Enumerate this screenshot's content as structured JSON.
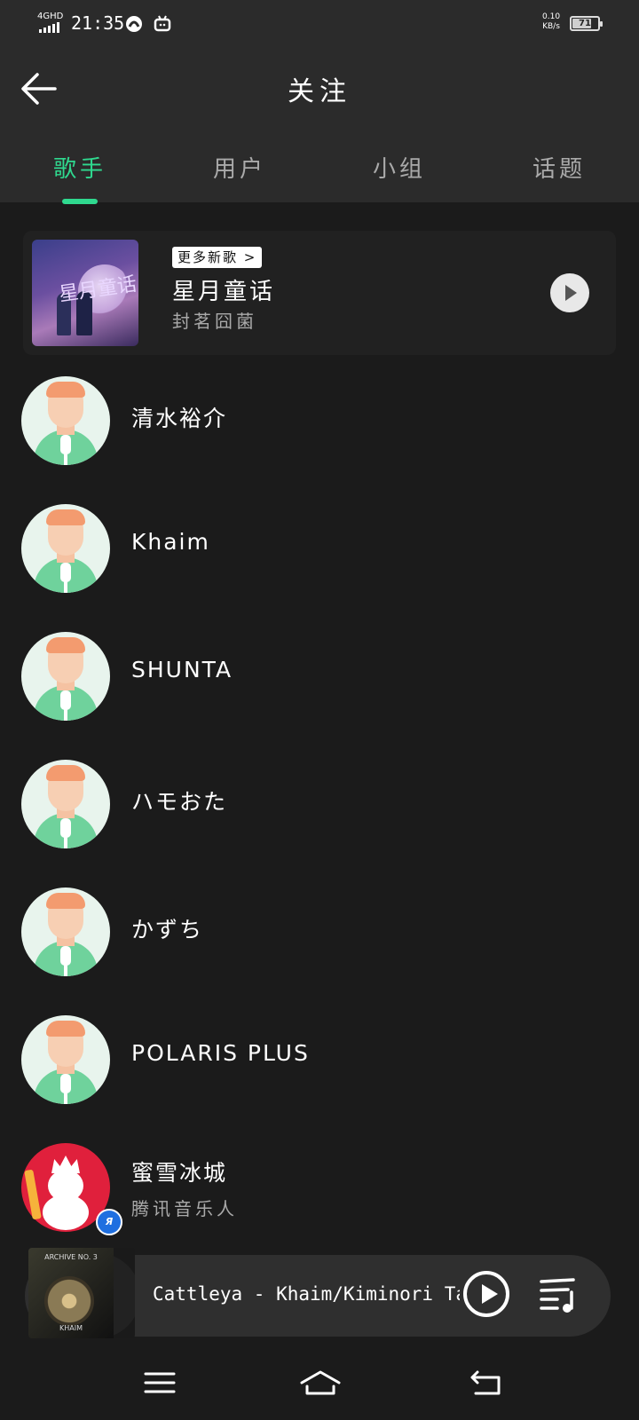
{
  "status": {
    "network": "4GHD",
    "time": "21:35",
    "speed_value": "0.10",
    "speed_unit": "KB/s",
    "battery": "71"
  },
  "header": {
    "title": "关注"
  },
  "tabs": [
    {
      "label": "歌手",
      "active": true
    },
    {
      "label": "用户",
      "active": false
    },
    {
      "label": "小组",
      "active": false
    },
    {
      "label": "话题",
      "active": false
    }
  ],
  "new_song_card": {
    "tag": "更多新歌 >",
    "title": "星月童话",
    "artist": "封茗囧菌"
  },
  "artists": [
    {
      "name": "清水裕介"
    },
    {
      "name": "Khaim"
    },
    {
      "name": "SHUNTA"
    },
    {
      "name": "ハモおた"
    },
    {
      "name": "かずち"
    },
    {
      "name": "POLARIS PLUS"
    },
    {
      "name": "蜜雪冰城",
      "subtitle": "腾讯音乐人"
    }
  ],
  "player": {
    "now_playing": "Cattleya - Khaim/Kiminori Tanaka",
    "cover_text_top": "ARCHIVE NO. 3",
    "cover_text_bottom": "KHAIM"
  },
  "colors": {
    "accent": "#2fd98f",
    "background": "#1b1b1b",
    "header_bg": "#2b2b2b"
  }
}
